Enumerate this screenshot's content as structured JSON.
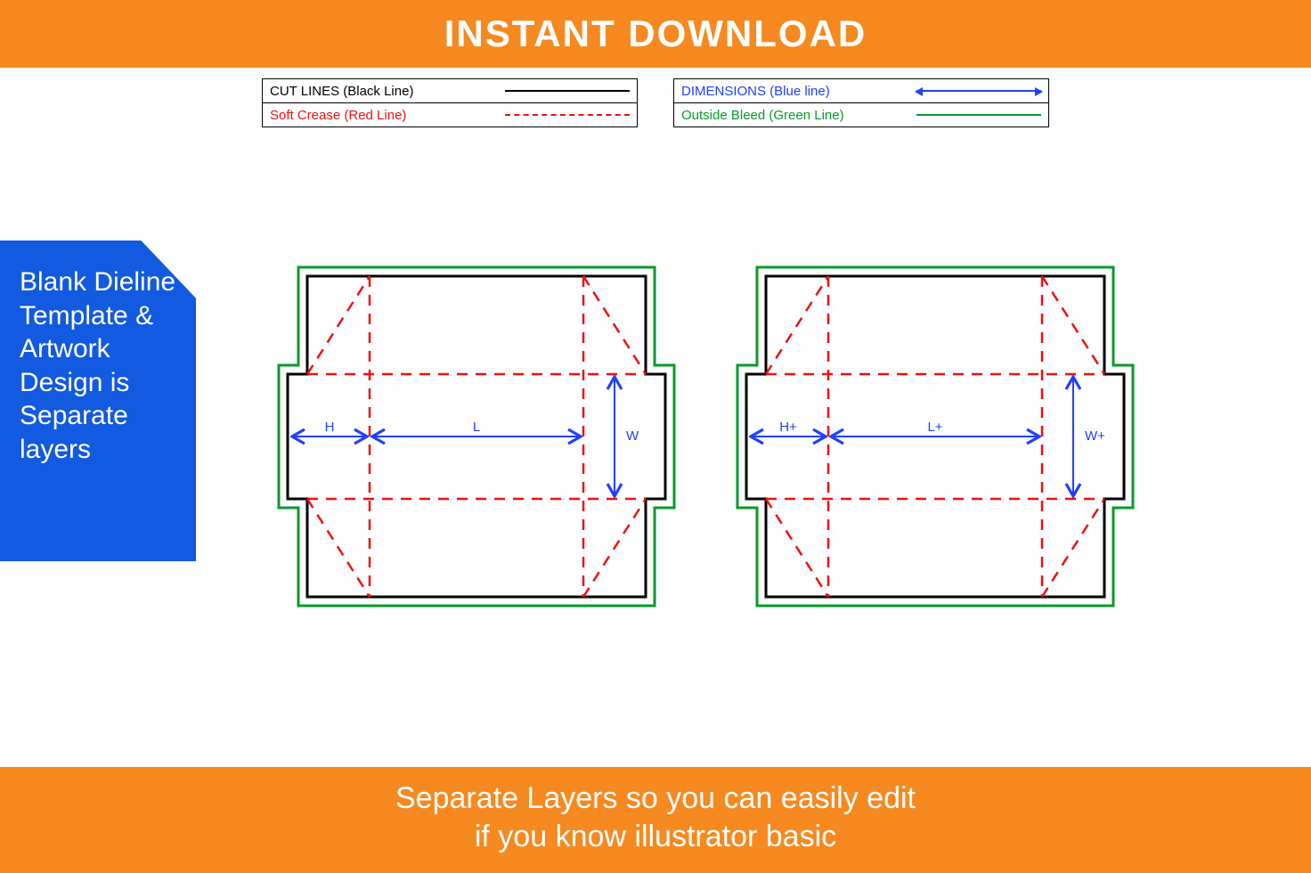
{
  "banner_top": "INSTANT DOWNLOAD",
  "legend": {
    "cut": "CUT LINES (Black Line)",
    "crease": "Soft Crease (Red Line)",
    "dim": "DIMENSIONS (Blue line)",
    "bleed": "Outside Bleed (Green Line)"
  },
  "side_text": "Blank Dieline Template & Artwork Design is Separate layers",
  "dims_left": {
    "h": "H",
    "l": "L",
    "w": "W"
  },
  "dims_right": {
    "h": "H+",
    "l": "L+",
    "w": "W+"
  },
  "banner_bottom_l1": "Separate Layers so you can easily edit",
  "banner_bottom_l2": "if you know illustrator basic"
}
